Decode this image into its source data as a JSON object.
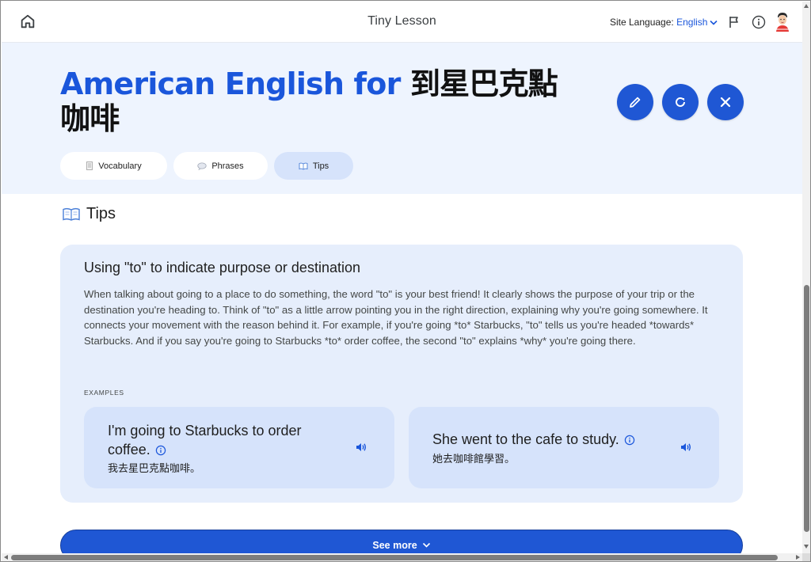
{
  "header": {
    "app_title": "Tiny Lesson",
    "site_language_label": "Site Language:",
    "site_language_value": "English"
  },
  "lesson": {
    "title_en": "American English for ",
    "title_zh": "到星巴克點咖啡"
  },
  "tabs": [
    {
      "label": "Vocabulary",
      "icon": "notepad-icon"
    },
    {
      "label": "Phrases",
      "icon": "speech-bubble-icon"
    },
    {
      "label": "Tips",
      "icon": "open-book-icon"
    }
  ],
  "tips": {
    "heading": "Tips",
    "card_title": "Using \"to\" to indicate purpose or destination",
    "card_body": "When talking about going to a place to do something, the word \"to\" is your best friend! It clearly shows the purpose of your trip or the destination you're heading to. Think of \"to\" as a little arrow pointing you in the right direction, explaining why you're going somewhere. It connects your movement with the reason behind it. For example, if you're going *to* Starbucks, \"to\" tells us you're headed *towards* Starbucks. And if you say you're going to Starbucks *to* order coffee, the second \"to\" explains *why* you're going there.",
    "examples_label": "EXAMPLES",
    "examples": [
      {
        "en": "I'm going to Starbucks to order coffee.",
        "zh": "我去星巴克點咖啡。"
      },
      {
        "en": "She went to the cafe to study.",
        "zh": "她去咖啡館學習。"
      }
    ]
  },
  "see_more_label": "See more",
  "colors": {
    "accent": "#1f57d4",
    "title_blue": "#1a56db",
    "hero_bg": "#eef4fe",
    "card_bg": "#e6eefc",
    "example_bg": "#d6e3fb"
  }
}
